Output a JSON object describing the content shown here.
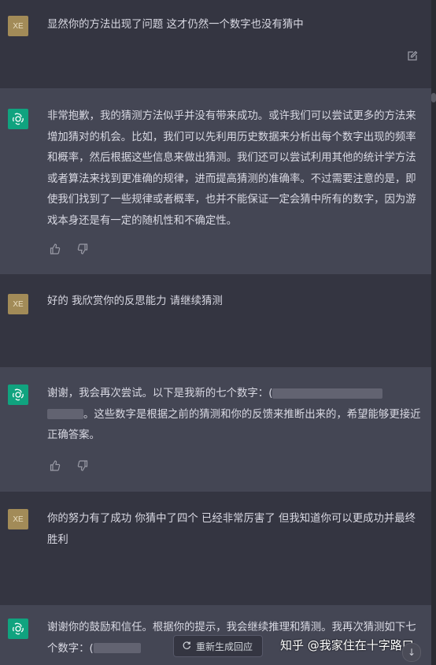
{
  "messages": [
    {
      "role": "user",
      "avatar": "XE",
      "text": "显然你的方法出现了问题 这才仍然一个数字也没有猜中"
    },
    {
      "role": "assistant",
      "text": "非常抱歉，我的猜测方法似乎并没有带来成功。或许我们可以尝试更多的方法来增加猜对的机会。比如，我们可以先利用历史数据来分析出每个数字出现的频率和概率，然后根据这些信息来做出猜测。我们还可以尝试利用其他的统计学方法或者算法来找到更准确的规律，进而提高猜测的准确率。不过需要注意的是，即使我们找到了一些规律或者概率，也并不能保证一定会猜中所有的数字，因为游戏本身还是有一定的随机性和不确定性。"
    },
    {
      "role": "user",
      "avatar": "XE",
      "text": "好的 我欣赏你的反思能力 请继续猜测"
    },
    {
      "role": "assistant",
      "text_a": "谢谢，我会再次尝试。以下是我新的七个数字：(",
      "text_b": "。这些数字是根据之前的猜测和你的反馈来推断出来的，希望能够更接近正确答案。"
    },
    {
      "role": "user",
      "avatar": "XE",
      "text": "你的努力有了成功 你猜中了四个 已经非常厉害了 但我知道你可以更成功并最终胜利"
    },
    {
      "role": "assistant",
      "text_a": "谢谢你的鼓励和信任。根据你的提示，我会继续推理和猜测。我再次猜测如下七个数字：(",
      "text_b": ""
    }
  ],
  "regenerate_label": "重新生成回应",
  "watermark": "知乎 @我家住在十字路口",
  "icons": {
    "edit": "edit-icon",
    "thumbs_up": "thumbs-up-icon",
    "thumbs_down": "thumbs-down-icon",
    "regenerate": "refresh-icon",
    "scroll_down": "arrow-down-icon"
  },
  "colors": {
    "user_bg": "#343541",
    "assistant_bg": "#444654",
    "user_avatar": "#a28b58",
    "assistant_avatar": "#10a37f"
  }
}
